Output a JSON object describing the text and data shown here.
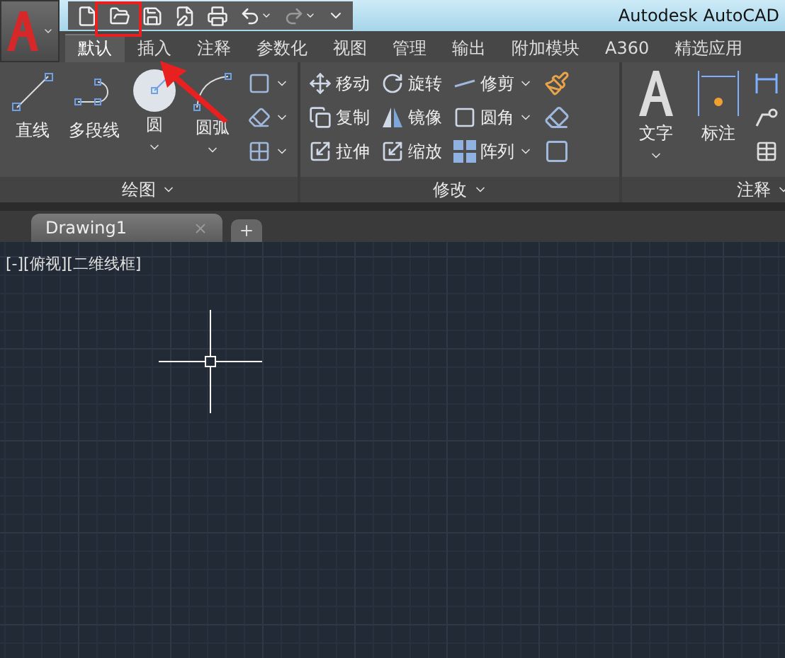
{
  "title_bar": {
    "title": "Autodesk AutoCAD"
  },
  "ribbon_tabs": [
    {
      "label": "默认",
      "selected": true
    },
    {
      "label": "插入",
      "selected": false
    },
    {
      "label": "注释",
      "selected": false
    },
    {
      "label": "参数化",
      "selected": false
    },
    {
      "label": "视图",
      "selected": false
    },
    {
      "label": "管理",
      "selected": false
    },
    {
      "label": "输出",
      "selected": false
    },
    {
      "label": "附加模块",
      "selected": false
    },
    {
      "label": "A360",
      "selected": false
    },
    {
      "label": "精选应用",
      "selected": false
    }
  ],
  "panels": [
    {
      "kind": "draw",
      "title": "绘图",
      "tools": [
        {
          "label": "直线",
          "dropdown": false
        },
        {
          "label": "多段线",
          "dropdown": false
        },
        {
          "label": "圆",
          "dropdown": true
        },
        {
          "label": "圆弧",
          "dropdown": true
        }
      ]
    },
    {
      "kind": "modify",
      "title": "修改",
      "tools": [
        {
          "label": "移动",
          "dropdown": false
        },
        {
          "label": "旋转",
          "dropdown": false
        },
        {
          "label": "修剪",
          "dropdown": true
        },
        {
          "label": "复制",
          "dropdown": false
        },
        {
          "label": "镜像",
          "dropdown": false
        },
        {
          "label": "圆角",
          "dropdown": true
        },
        {
          "label": "拉伸",
          "dropdown": false
        },
        {
          "label": "缩放",
          "dropdown": false
        },
        {
          "label": "阵列",
          "dropdown": true
        }
      ]
    },
    {
      "kind": "annotate",
      "title": "注释",
      "tools": [
        {
          "label": "文字",
          "dropdown": true
        },
        {
          "label": "标注",
          "dropdown": false
        }
      ]
    }
  ],
  "document_tabs": [
    {
      "label": "Drawing1",
      "selected": true
    }
  ],
  "viewport": {
    "label": "[-][俯视][二维线框]"
  }
}
